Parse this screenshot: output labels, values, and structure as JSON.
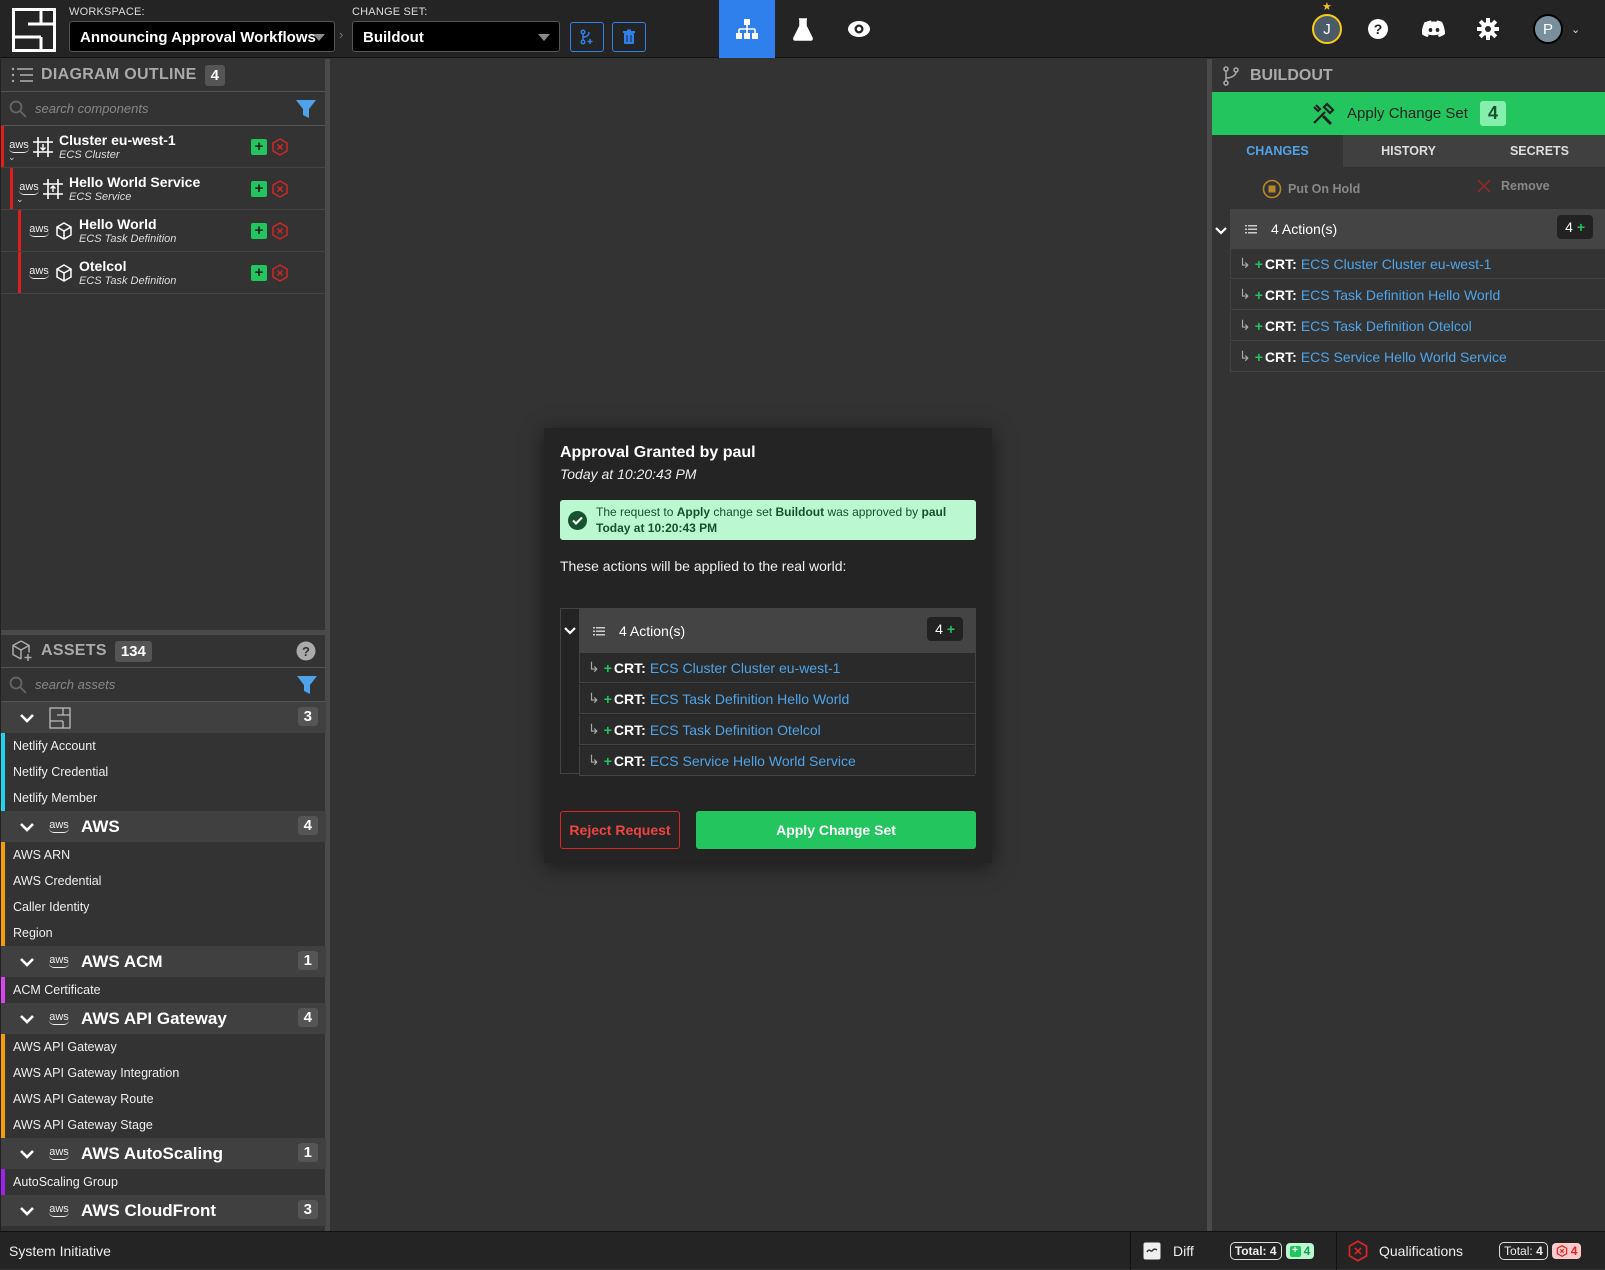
{
  "topbar": {
    "workspace_label": "WORKSPACE:",
    "workspace_value": "Announcing Approval Workflows",
    "changeset_label": "CHANGE SET:",
    "changeset_value": "Buildout",
    "nav_tabs": [
      {
        "name": "model",
        "icon": "diagram-icon",
        "active": true
      },
      {
        "name": "lab",
        "icon": "beaker-icon",
        "active": false
      },
      {
        "name": "view",
        "icon": "eye-icon",
        "active": false
      }
    ],
    "user_badge": "J",
    "profile_initial": "P",
    "accent": "#2f80ed"
  },
  "outline": {
    "title": "DIAGRAM OUTLINE",
    "count": "4",
    "search_placeholder": "search components",
    "items": [
      {
        "name": "Cluster eu-west-1",
        "type": "ECS Cluster",
        "icon": "ecs-cluster-icon"
      },
      {
        "name": "Hello World Service",
        "type": "ECS Service",
        "icon": "ecs-service-icon"
      },
      {
        "name": "Hello World",
        "type": "ECS Task Definition",
        "icon": "cube-icon"
      },
      {
        "name": "Otelcol",
        "type": "ECS Task Definition",
        "icon": "cube-icon"
      }
    ]
  },
  "assets": {
    "title": "ASSETS",
    "count": "134",
    "search_placeholder": "search assets",
    "groups": [
      {
        "name": "",
        "count": "3",
        "color": "#22d3ee",
        "items": [
          "Netlify Account",
          "Netlify Credential",
          "Netlify Member"
        ]
      },
      {
        "name": "AWS",
        "count": "4",
        "color": "#f59e0b",
        "items": [
          "AWS ARN",
          "AWS Credential",
          "Caller Identity",
          "Region"
        ]
      },
      {
        "name": "AWS ACM",
        "count": "1",
        "color": "#d946ef",
        "items": [
          "ACM Certificate"
        ]
      },
      {
        "name": "AWS API Gateway",
        "count": "4",
        "color": "#f59e0b",
        "items": [
          "AWS API Gateway",
          "AWS API Gateway Integration",
          "AWS API Gateway Route",
          "AWS API Gateway Stage"
        ]
      },
      {
        "name": "AWS AutoScaling",
        "count": "1",
        "color": "#a020f0",
        "items": [
          "AutoScaling Group"
        ]
      },
      {
        "name": "AWS CloudFront",
        "count": "3",
        "color": "#84cc16",
        "items": []
      }
    ]
  },
  "modal": {
    "title": "Approval Granted by paul",
    "timestamp": "Today at 10:20:43 PM",
    "notice": {
      "p1": "The request to ",
      "b1": "Apply",
      "p2": " change set ",
      "b2": "Buildout",
      "p3": " was approved by ",
      "b3": "paul",
      "b4": "Today at 10:20:43 PM"
    },
    "lead": "These actions will be applied to the real world:",
    "actions_label": "4 Action(s)",
    "actions_count": "4",
    "reject_label": "Reject Request",
    "apply_label": "Apply Change Set"
  },
  "actions": [
    {
      "kind": "CRT:",
      "target": "ECS Cluster Cluster eu-west-1"
    },
    {
      "kind": "CRT:",
      "target": "ECS Task Definition Hello World"
    },
    {
      "kind": "CRT:",
      "target": "ECS Task Definition Otelcol"
    },
    {
      "kind": "CRT:",
      "target": "ECS Service Hello World Service"
    }
  ],
  "right_panel": {
    "title": "BUILDOUT",
    "apply_label": "Apply Change Set",
    "apply_count": "4",
    "tabs": [
      "CHANGES",
      "HISTORY",
      "SECRETS"
    ],
    "hold_label": "Put On Hold",
    "remove_label": "Remove",
    "actions_label": "4 Action(s)",
    "actions_count": "4"
  },
  "footer": {
    "brand": "System Initiative",
    "diff_label": "Diff",
    "diff_total_label": "Total:",
    "diff_total": "4",
    "diff_added": "4",
    "qual_label": "Qualifications",
    "qual_total_label": "Total:",
    "qual_total": "4",
    "qual_failed": "4"
  }
}
